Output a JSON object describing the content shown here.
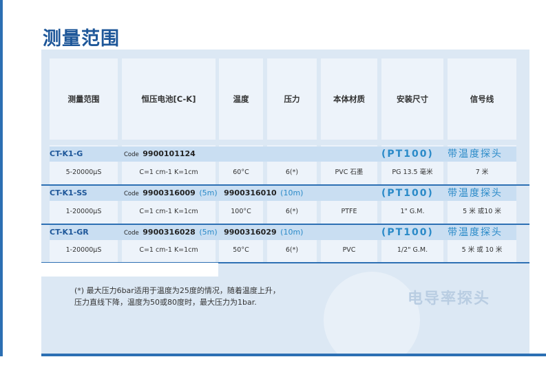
{
  "title": "测量范围",
  "headers": [
    "测量范围",
    "恒压电池[C-K]",
    "温度",
    "压力",
    "本体材质",
    "安装尺寸",
    "信号线"
  ],
  "code_label": "Code",
  "pt100": "(PT100)",
  "probe_label": "带温度探头",
  "rows": [
    {
      "model": "CT-K1-G",
      "code1": "9900101124",
      "len1": "",
      "code2": "",
      "len2": "",
      "range": "5-20000µS",
      "cell": "C=1 cm-1 K=1cm",
      "temp": "60°C",
      "pressure": "6(*)",
      "material": "PVC 石墨",
      "mount": "PG 13.5 毫米",
      "cable": "7 米"
    },
    {
      "model": "CT-K1-SS",
      "code1": "9900316009",
      "len1": "(5m)",
      "code2": "9900316010",
      "len2": "(10m)",
      "range": "1-20000µS",
      "cell": "C=1 cm-1 K=1cm",
      "temp": "100°C",
      "pressure": "6(*)",
      "material": "PTFE",
      "mount": "1\" G.M.",
      "cable": "5 米 或10 米"
    },
    {
      "model": "CT-K1-GR",
      "code1": "9900316028",
      "len1": "(5m)",
      "code2": "9900316029",
      "len2": "(10m)",
      "range": "1-20000µS",
      "cell": "C=1 cm-1 K=1cm",
      "temp": "50°C",
      "pressure": "6(*)",
      "material": "PVC",
      "mount": "1/2\" G.M.",
      "cable": "5 米 或 10 米"
    }
  ],
  "note": "(*)  最大压力6bar适用于温度为25度的情况，随着温度上升，压力直线下降，温度为50或80度时，最大压力为1bar.",
  "watermark": "电导率探头",
  "colors": {
    "brand_blue": "#1e5799",
    "accent_blue": "#2a8ac8",
    "panel": "#dce8f4",
    "cell": "#edf3fa"
  }
}
